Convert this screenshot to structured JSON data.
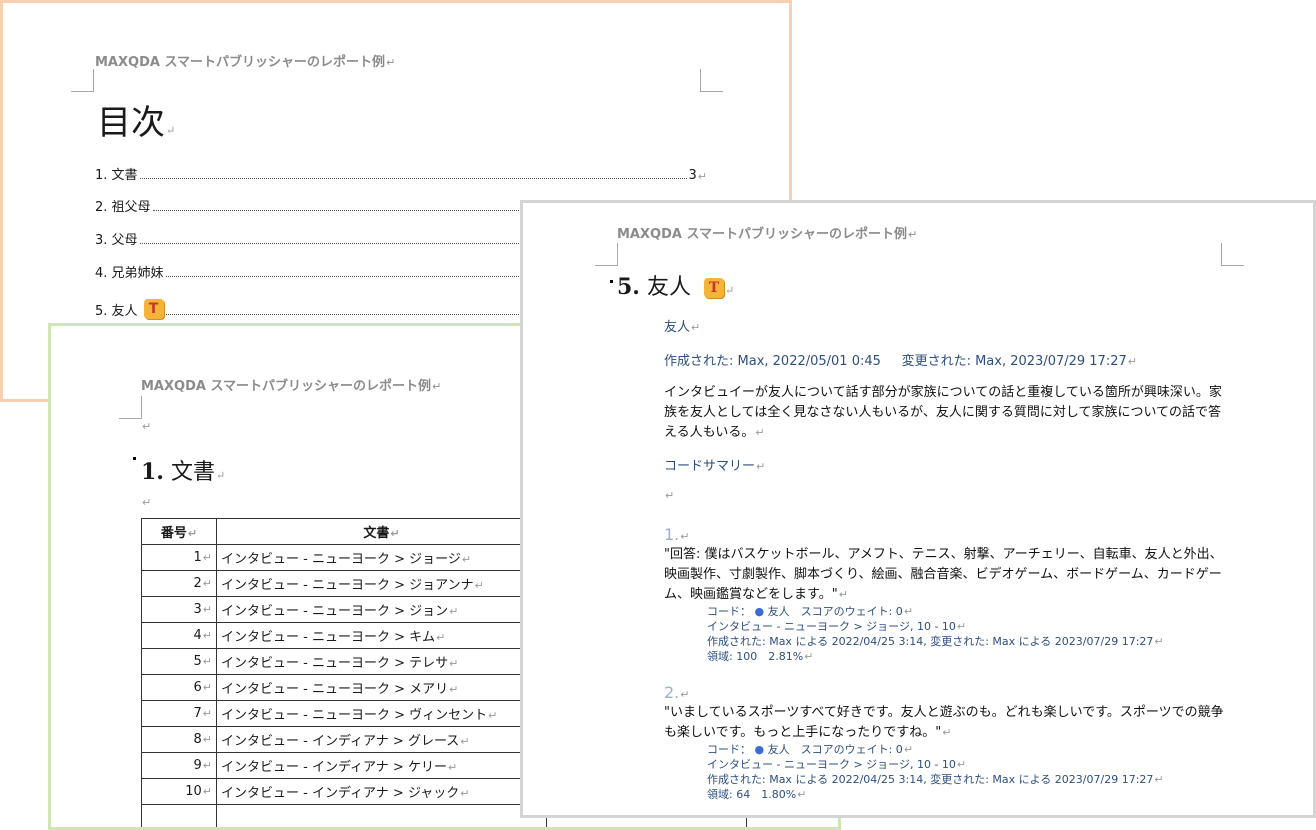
{
  "header_text": "MAXQDA スマートパブリッシャーのレポート例",
  "para_mark": "↵",
  "toc": {
    "title": "目次",
    "entries": [
      {
        "label": "1. 文書",
        "page": "3"
      },
      {
        "label": "2. 祖父母",
        "page": ""
      },
      {
        "label": "3. 父母",
        "page": ""
      },
      {
        "label": "4. 兄弟姉妹",
        "page": ""
      },
      {
        "label": "5. 友人",
        "page": ""
      }
    ]
  },
  "icon_letter": "T",
  "docs": {
    "heading_num": "1.",
    "heading_text": "文書",
    "columns": [
      "番号",
      "文書"
    ],
    "rows": [
      {
        "n": "1",
        "doc": "インタビュー - ニューヨーク > ジョージ"
      },
      {
        "n": "2",
        "doc": "インタビュー - ニューヨーク > ジョアンナ"
      },
      {
        "n": "3",
        "doc": "インタビュー - ニューヨーク > ジョン"
      },
      {
        "n": "4",
        "doc": "インタビュー - ニューヨーク > キム"
      },
      {
        "n": "5",
        "doc": "インタビュー - ニューヨーク > テレサ"
      },
      {
        "n": "6",
        "doc": "インタビュー - ニューヨーク > メアリ"
      },
      {
        "n": "7",
        "doc": "インタビュー - ニューヨーク > ヴィンセント"
      },
      {
        "n": "8",
        "doc": "インタビュー - インディアナ > グレース"
      },
      {
        "n": "9",
        "doc": "インタビュー - インディアナ > ケリー"
      },
      {
        "n": "10",
        "doc": "インタビュー - インディアナ > ジャック"
      }
    ]
  },
  "friends": {
    "heading_num": "5.",
    "heading_text": "友人",
    "code_name": "友人",
    "created": "作成された: Max, 2022/05/01 0:45",
    "modified": "変更された: Max, 2023/07/29 17:27",
    "memo": "インタビュイーが友人について話す部分が家族についての話と重複している箇所が興味深い。家族を友人としては全く見なさない人もいるが、友人に関する質問に対して家族についての話で答える人もいる。",
    "summary_label": "コードサマリー",
    "segments": [
      {
        "num": "1.",
        "text": "\"回答: 僕はバスケットボール、アメフト、テニス、射撃、アーチェリー、自転車、友人と外出、映画製作、寸劇製作、脚本づくり、絵画、融合音楽、ビデオゲーム、ボードゲーム、カードゲーム、映画鑑賞などをします。\"",
        "code_prefix": "コード：",
        "code_dot": "●",
        "code_rest": "友人　スコアのウェイト: 0",
        "doc_ref": "インタビュー - ニューヨーク > ジョージ, 10 - 10",
        "dates": "作成された: Max による 2022/04/25 3:14, 変更された: Max による 2023/07/29 17:27",
        "area": "領域: 100　2.81%"
      },
      {
        "num": "2.",
        "text": "\"いましているスポーツすべて好きです。友人と遊ぶのも。どれも楽しいです。スポーツでの競争も楽しいです。もっと上手になったりですね。\"",
        "code_prefix": "コード：",
        "code_dot": "●",
        "code_rest": "友人　スコアのウェイト: 0",
        "doc_ref": "インタビュー - ニューヨーク > ジョージ, 10 - 10",
        "dates": "作成された: Max による 2022/04/25 3:14, 変更された: Max による 2023/07/29 17:27",
        "area": "領域: 64　1.80%"
      }
    ]
  }
}
